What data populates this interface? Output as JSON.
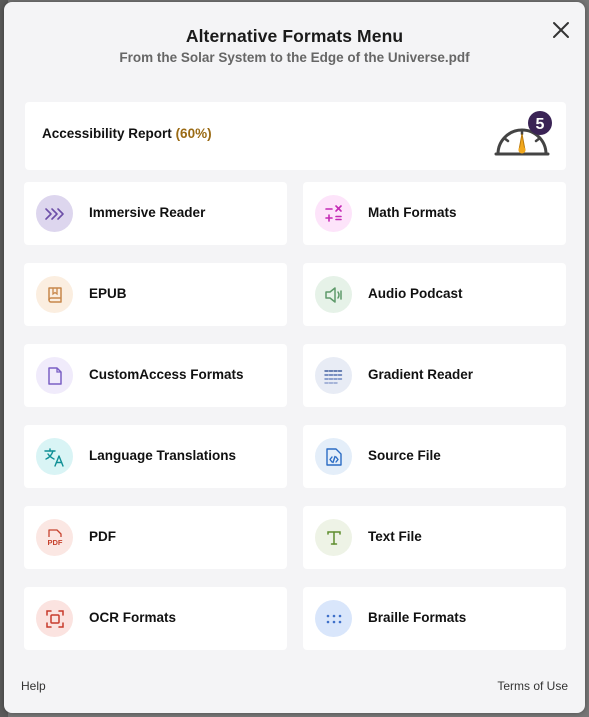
{
  "modal": {
    "title": "Alternative Formats Menu",
    "subtitle": "From the Solar System to the Edge of the Universe.pdf"
  },
  "report": {
    "label": "Accessibility Report",
    "percent": "(60%)",
    "score": "5"
  },
  "formats": [
    {
      "label": "Immersive Reader",
      "icon": "immersive-reader-icon",
      "color": "#6d4fa8",
      "bg": "#ddd6ee"
    },
    {
      "label": "Math Formats",
      "icon": "math-formats-icon",
      "color": "#c42ab5",
      "bg": "#fde4fa"
    },
    {
      "label": "EPUB",
      "icon": "book-icon",
      "color": "#c8874a",
      "bg": "#fbeee0"
    },
    {
      "label": "Audio Podcast",
      "icon": "speaker-icon",
      "color": "#5e9a6a",
      "bg": "#e6f2e8"
    },
    {
      "label": "CustomAccess Formats",
      "icon": "document-icon",
      "color": "#7a5fc5",
      "bg": "#f0ebfb"
    },
    {
      "label": "Gradient Reader",
      "icon": "gradient-lines-icon",
      "color": "#3f5c9c",
      "bg": "#e8ecf5"
    },
    {
      "label": "Language Translations",
      "icon": "translate-icon",
      "color": "#0f8f95",
      "bg": "#d9f4f5"
    },
    {
      "label": "Source File",
      "icon": "source-code-icon",
      "color": "#2b6cc4",
      "bg": "#e4eef9"
    },
    {
      "label": "PDF",
      "icon": "pdf-icon",
      "color": "#c7432f",
      "bg": "#fbe7e3"
    },
    {
      "label": "Text File",
      "icon": "text-t-icon",
      "color": "#5f8e2f",
      "bg": "#eef3e6"
    },
    {
      "label": "OCR Formats",
      "icon": "ocr-scan-icon",
      "color": "#c73a2b",
      "bg": "#fbe3e0"
    },
    {
      "label": "Braille Formats",
      "icon": "braille-dots-icon",
      "color": "#3d6fc9",
      "bg": "#d9e6fb"
    }
  ],
  "footer": {
    "help": "Help",
    "terms": "Terms of Use"
  }
}
